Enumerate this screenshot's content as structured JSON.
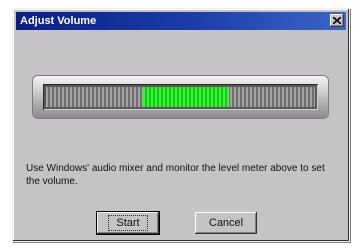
{
  "dialog": {
    "title": "Adjust Volume",
    "close_icon": "close-x-icon"
  },
  "level_meter": {
    "level_start_fraction": 0.36,
    "level_end_fraction": 0.68,
    "lit_color": "#3cf43c",
    "unlit_color": "#a3a3a3"
  },
  "instructions": "Use Windows' audio mixer and monitor the level meter above to set the volume.",
  "buttons": {
    "start_label": "Start",
    "cancel_label": "Cancel"
  },
  "colors": {
    "titlebar_start": "#0a1f86",
    "titlebar_end": "#3b66c9",
    "face": "#c6c3c6"
  }
}
